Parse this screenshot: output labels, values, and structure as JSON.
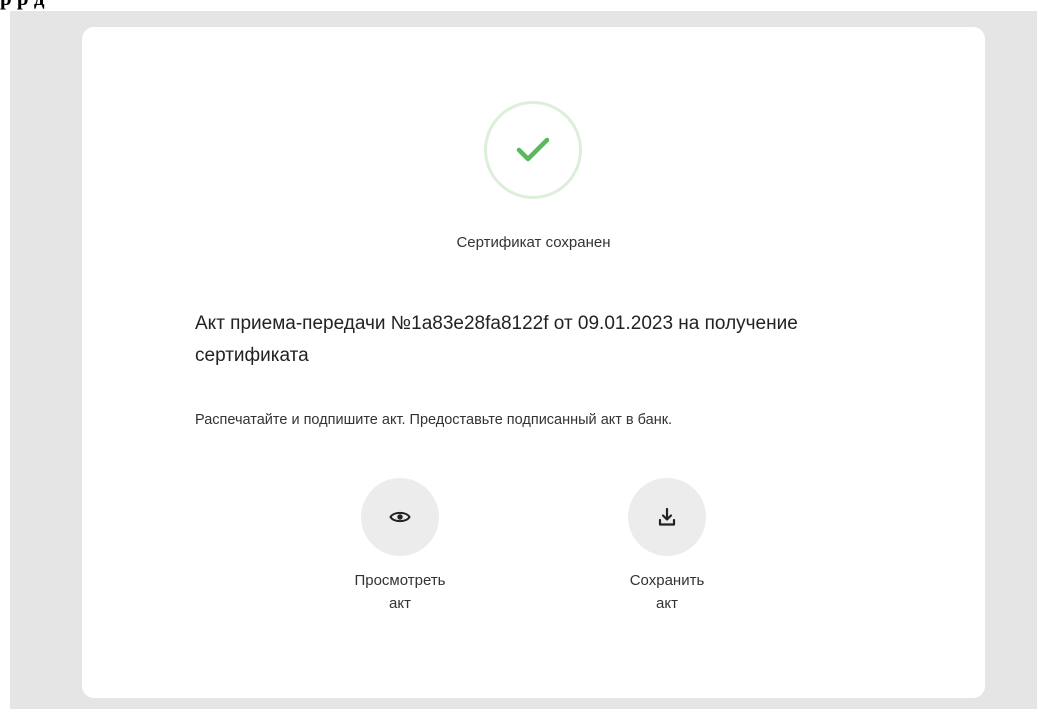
{
  "page": {
    "heading_fragment": "р    р д"
  },
  "status": {
    "icon": "check-icon",
    "accent_color": "#5cb85c",
    "text": "Сертификат сохранен"
  },
  "act": {
    "title": "Акт приема-передачи №1a83e28fa8122f от 09.01.2023 на получение сертификата",
    "instruction": "Распечатайте и подпишите акт. Предоставьте подписанный акт в банк."
  },
  "actions": [
    {
      "icon": "eye-icon",
      "label_line1": "Просмотреть",
      "label_line2": "акт"
    },
    {
      "icon": "download-icon",
      "label_line1": "Сохранить",
      "label_line2": "акт"
    }
  ]
}
